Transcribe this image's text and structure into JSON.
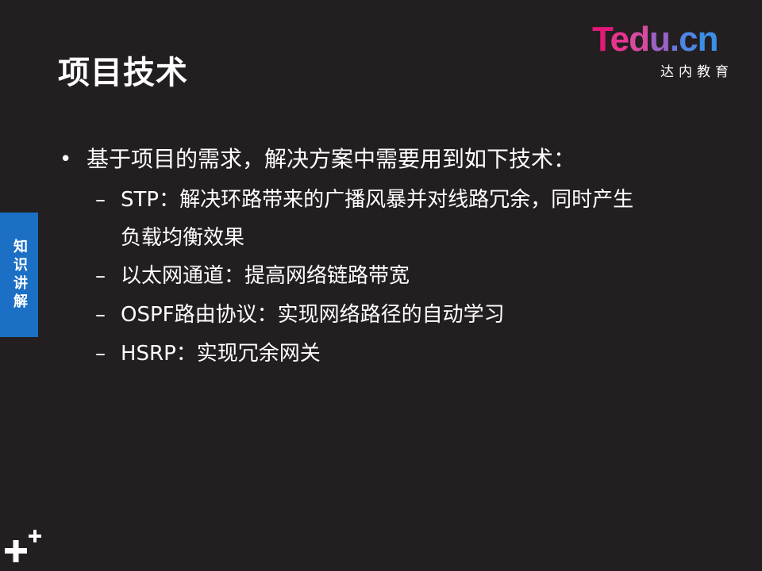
{
  "slide": {
    "title": "项目技术",
    "side_tab": "知识讲解"
  },
  "logo": {
    "brand_letters": [
      "T",
      "e",
      "d",
      "u",
      ".",
      "c",
      "n"
    ],
    "subtitle": "达内教育",
    "colors": [
      "#e2187a",
      "#e7358f",
      "#d64aa0",
      "#9a62c4",
      "#6a78dc",
      "#4f86e3",
      "#3a8fe8"
    ]
  },
  "content": {
    "bullet": "基于项目的需求，解决方案中需要用到如下技术：",
    "sub_items": [
      "STP：解决环路带来的广播风暴并对线路冗余，同时产生负载均衡效果",
      "以太网通道：提高网络链路带宽",
      "OSPF路由协议：实现网络路径的自动学习",
      "HSRP：实现冗余网关"
    ]
  },
  "colors": {
    "background": "#231f20",
    "side_tab": "#1b6fc4",
    "text": "#ffffff"
  },
  "icons": [
    "plus-icon"
  ]
}
